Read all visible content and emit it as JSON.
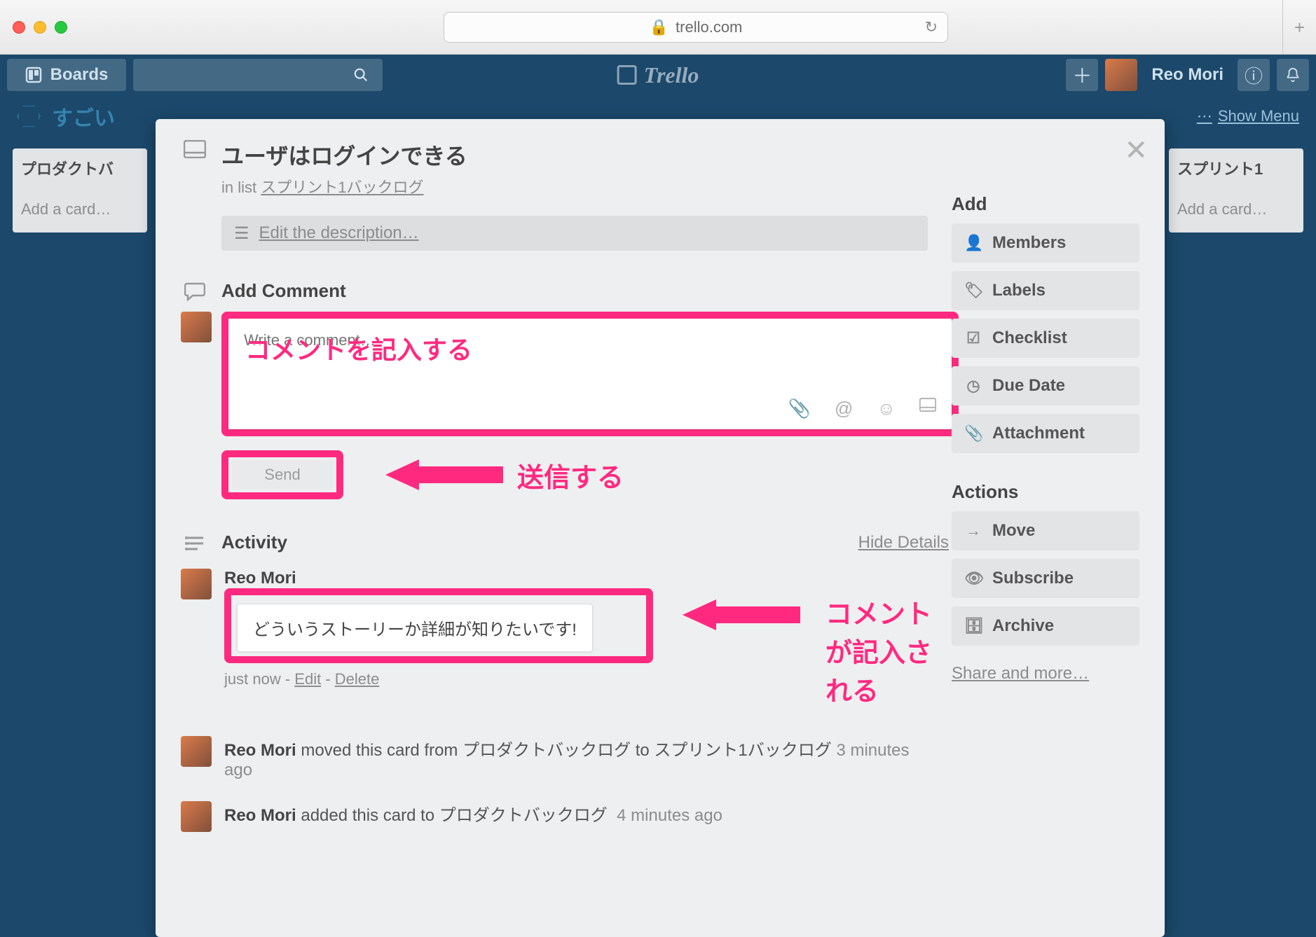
{
  "browser": {
    "domain": "trello.com"
  },
  "header": {
    "boards_label": "Boards",
    "user_name": "Reo Mori",
    "logo_text": "Trello"
  },
  "board": {
    "name_partial": "すごい",
    "show_menu": "Show Menu",
    "lists": {
      "left": {
        "title": "プロダクトバ",
        "add_card": "Add a card…"
      },
      "right": {
        "title": "スプリント1",
        "add_card": "Add a card…"
      }
    }
  },
  "card": {
    "title": "ユーザはログインできる",
    "in_list_prefix": "in list ",
    "in_list_link": "スプリント1バックログ",
    "edit_description": "Edit the description…",
    "add_comment_title": "Add Comment",
    "comment_placeholder": "Write a comment…",
    "send_label": "Send",
    "activity_title": "Activity",
    "hide_details": "Hide Details"
  },
  "annotations": {
    "write_comment": "コメントを記入する",
    "send": "送信する",
    "comment_written": "コメントが記入される"
  },
  "activity": [
    {
      "author": "Reo Mori",
      "comment": "どういうストーリーか詳細が知りたいです!",
      "time": "just now",
      "edit": "Edit",
      "delete": "Delete"
    },
    {
      "author": "Reo Mori",
      "text_suffix": " moved this card from プロダクトバックログ to スプリント1バックログ",
      "time": "3 minutes ago"
    },
    {
      "author": "Reo Mori",
      "text_suffix": " added this card to プロダクトバックログ",
      "time": "4 minutes ago"
    }
  ],
  "sidebar": {
    "add_title": "Add",
    "add_items": [
      "Members",
      "Labels",
      "Checklist",
      "Due Date",
      "Attachment"
    ],
    "actions_title": "Actions",
    "action_items": [
      "Move",
      "Subscribe",
      "Archive"
    ],
    "share_more": "Share and more…"
  }
}
